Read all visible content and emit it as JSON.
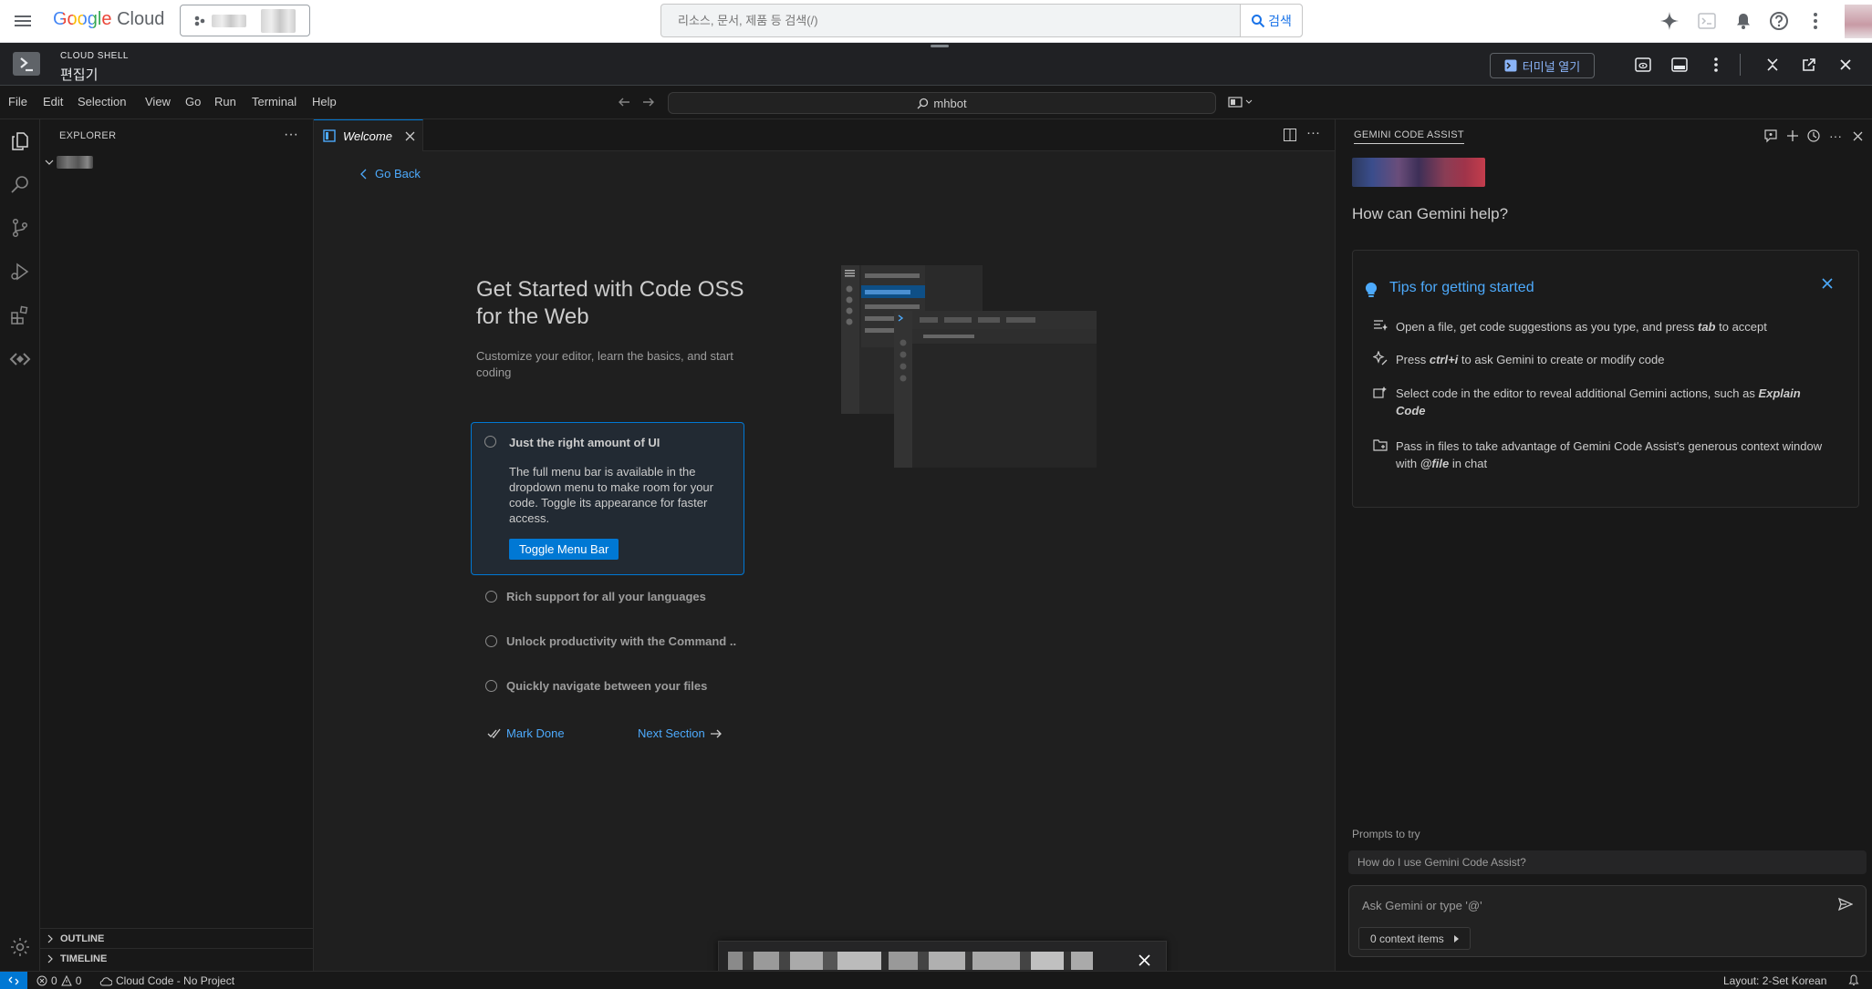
{
  "gcloud": {
    "logo_google": "Google",
    "logo_cloud": "Cloud",
    "search_placeholder": "리소스, 문서, 제품 등 검색(/)",
    "search_button": "검색"
  },
  "cloud_shell": {
    "label_small": "CLOUD SHELL",
    "label_big": "편집기",
    "open_terminal": "터미널 열기"
  },
  "menubar": {
    "items": [
      "File",
      "Edit",
      "Selection",
      "View",
      "Go",
      "Run",
      "Terminal",
      "Help"
    ],
    "command_center": "mhbot"
  },
  "sidebar": {
    "title": "EXPLORER",
    "outline": "OUTLINE",
    "timeline": "TIMELINE"
  },
  "editor": {
    "tab_label": "Welcome",
    "go_back": "Go Back",
    "title": "Get Started with Code OSS for the Web",
    "description": "Customize your editor, learn the basics, and start coding",
    "active_step": {
      "title": "Just the right amount of UI",
      "body": "The full menu bar is available in the dropdown menu to make room for your code. Toggle its appearance for faster access.",
      "button": "Toggle Menu Bar"
    },
    "steps": [
      "Rich support for all your languages",
      "Unlock productivity with the Command ..",
      "Quickly navigate between your files"
    ],
    "mark_done": "Mark Done",
    "next_section": "Next Section"
  },
  "gemini": {
    "title": "GEMINI CODE ASSIST",
    "help_heading": "How can Gemini help?",
    "tips_title": "Tips for getting started",
    "tips": [
      {
        "pre": "Open a file, get code suggestions as you type, and press ",
        "em": "tab",
        "post": " to accept"
      },
      {
        "pre": "Press ",
        "em": "ctrl+i",
        "post": " to ask Gemini to create or modify code"
      },
      {
        "pre": "Select code in the editor to reveal additional Gemini actions, such as ",
        "em": "Explain Code",
        "post": ""
      },
      {
        "pre": "Pass in files to take advantage of Gemini Code Assist's generous context window with ",
        "em": "@file",
        "post": " in chat"
      }
    ],
    "prompts_label": "Prompts to try",
    "prompt_suggestion": "How do I use Gemini Code Assist?",
    "input_placeholder": "Ask Gemini or type '@'",
    "context_items": "0 context items"
  },
  "statusbar": {
    "errors": "0",
    "warnings": "0",
    "cloud_code": "Cloud Code - No Project",
    "layout": "Layout: 2-Set Korean"
  },
  "colors": {
    "accent": "#0078d4",
    "link": "#4daafc",
    "gcloud_blue": "#1a73e8"
  }
}
